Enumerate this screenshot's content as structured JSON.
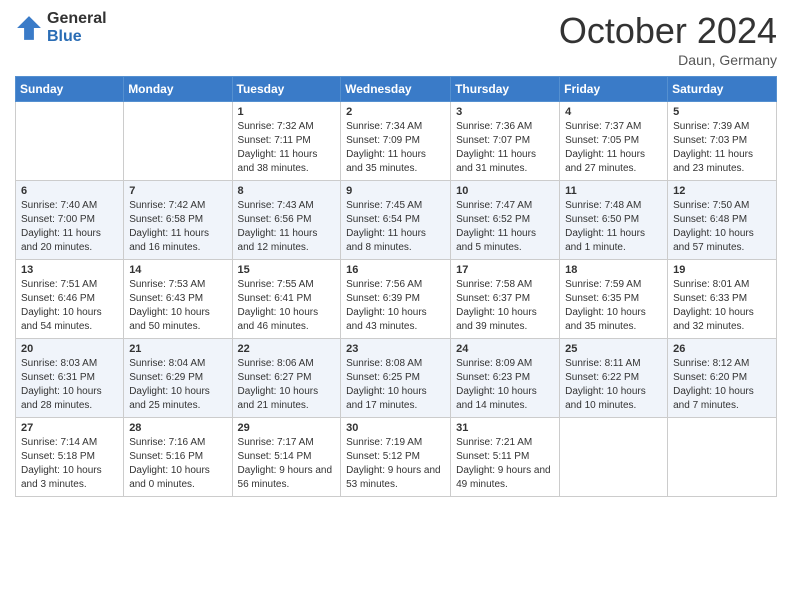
{
  "header": {
    "logo_general": "General",
    "logo_blue": "Blue",
    "month_title": "October 2024",
    "location": "Daun, Germany"
  },
  "weekdays": [
    "Sunday",
    "Monday",
    "Tuesday",
    "Wednesday",
    "Thursday",
    "Friday",
    "Saturday"
  ],
  "weeks": [
    [
      {
        "day": "",
        "info": ""
      },
      {
        "day": "",
        "info": ""
      },
      {
        "day": "1",
        "info": "Sunrise: 7:32 AM\nSunset: 7:11 PM\nDaylight: 11 hours and 38 minutes."
      },
      {
        "day": "2",
        "info": "Sunrise: 7:34 AM\nSunset: 7:09 PM\nDaylight: 11 hours and 35 minutes."
      },
      {
        "day": "3",
        "info": "Sunrise: 7:36 AM\nSunset: 7:07 PM\nDaylight: 11 hours and 31 minutes."
      },
      {
        "day": "4",
        "info": "Sunrise: 7:37 AM\nSunset: 7:05 PM\nDaylight: 11 hours and 27 minutes."
      },
      {
        "day": "5",
        "info": "Sunrise: 7:39 AM\nSunset: 7:03 PM\nDaylight: 11 hours and 23 minutes."
      }
    ],
    [
      {
        "day": "6",
        "info": "Sunrise: 7:40 AM\nSunset: 7:00 PM\nDaylight: 11 hours and 20 minutes."
      },
      {
        "day": "7",
        "info": "Sunrise: 7:42 AM\nSunset: 6:58 PM\nDaylight: 11 hours and 16 minutes."
      },
      {
        "day": "8",
        "info": "Sunrise: 7:43 AM\nSunset: 6:56 PM\nDaylight: 11 hours and 12 minutes."
      },
      {
        "day": "9",
        "info": "Sunrise: 7:45 AM\nSunset: 6:54 PM\nDaylight: 11 hours and 8 minutes."
      },
      {
        "day": "10",
        "info": "Sunrise: 7:47 AM\nSunset: 6:52 PM\nDaylight: 11 hours and 5 minutes."
      },
      {
        "day": "11",
        "info": "Sunrise: 7:48 AM\nSunset: 6:50 PM\nDaylight: 11 hours and 1 minute."
      },
      {
        "day": "12",
        "info": "Sunrise: 7:50 AM\nSunset: 6:48 PM\nDaylight: 10 hours and 57 minutes."
      }
    ],
    [
      {
        "day": "13",
        "info": "Sunrise: 7:51 AM\nSunset: 6:46 PM\nDaylight: 10 hours and 54 minutes."
      },
      {
        "day": "14",
        "info": "Sunrise: 7:53 AM\nSunset: 6:43 PM\nDaylight: 10 hours and 50 minutes."
      },
      {
        "day": "15",
        "info": "Sunrise: 7:55 AM\nSunset: 6:41 PM\nDaylight: 10 hours and 46 minutes."
      },
      {
        "day": "16",
        "info": "Sunrise: 7:56 AM\nSunset: 6:39 PM\nDaylight: 10 hours and 43 minutes."
      },
      {
        "day": "17",
        "info": "Sunrise: 7:58 AM\nSunset: 6:37 PM\nDaylight: 10 hours and 39 minutes."
      },
      {
        "day": "18",
        "info": "Sunrise: 7:59 AM\nSunset: 6:35 PM\nDaylight: 10 hours and 35 minutes."
      },
      {
        "day": "19",
        "info": "Sunrise: 8:01 AM\nSunset: 6:33 PM\nDaylight: 10 hours and 32 minutes."
      }
    ],
    [
      {
        "day": "20",
        "info": "Sunrise: 8:03 AM\nSunset: 6:31 PM\nDaylight: 10 hours and 28 minutes."
      },
      {
        "day": "21",
        "info": "Sunrise: 8:04 AM\nSunset: 6:29 PM\nDaylight: 10 hours and 25 minutes."
      },
      {
        "day": "22",
        "info": "Sunrise: 8:06 AM\nSunset: 6:27 PM\nDaylight: 10 hours and 21 minutes."
      },
      {
        "day": "23",
        "info": "Sunrise: 8:08 AM\nSunset: 6:25 PM\nDaylight: 10 hours and 17 minutes."
      },
      {
        "day": "24",
        "info": "Sunrise: 8:09 AM\nSunset: 6:23 PM\nDaylight: 10 hours and 14 minutes."
      },
      {
        "day": "25",
        "info": "Sunrise: 8:11 AM\nSunset: 6:22 PM\nDaylight: 10 hours and 10 minutes."
      },
      {
        "day": "26",
        "info": "Sunrise: 8:12 AM\nSunset: 6:20 PM\nDaylight: 10 hours and 7 minutes."
      }
    ],
    [
      {
        "day": "27",
        "info": "Sunrise: 7:14 AM\nSunset: 5:18 PM\nDaylight: 10 hours and 3 minutes."
      },
      {
        "day": "28",
        "info": "Sunrise: 7:16 AM\nSunset: 5:16 PM\nDaylight: 10 hours and 0 minutes."
      },
      {
        "day": "29",
        "info": "Sunrise: 7:17 AM\nSunset: 5:14 PM\nDaylight: 9 hours and 56 minutes."
      },
      {
        "day": "30",
        "info": "Sunrise: 7:19 AM\nSunset: 5:12 PM\nDaylight: 9 hours and 53 minutes."
      },
      {
        "day": "31",
        "info": "Sunrise: 7:21 AM\nSunset: 5:11 PM\nDaylight: 9 hours and 49 minutes."
      },
      {
        "day": "",
        "info": ""
      },
      {
        "day": "",
        "info": ""
      }
    ]
  ]
}
